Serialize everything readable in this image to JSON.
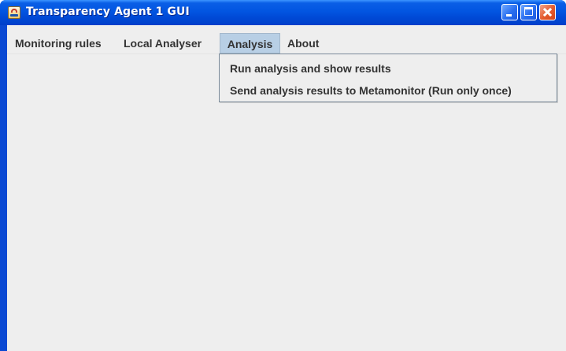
{
  "window": {
    "title": "Transparency Agent 1 GUI",
    "icon": "java-icon",
    "controls": [
      "minimize-icon",
      "maximize-icon",
      "close-icon"
    ],
    "accent_color": "#0a49d3"
  },
  "menubar": {
    "items": [
      {
        "label": "Monitoring rules"
      },
      {
        "label": "Local Analyser"
      },
      {
        "label": "Analysis",
        "active": true
      },
      {
        "label": "About"
      }
    ]
  },
  "analysis_menu": {
    "items": [
      {
        "label": "Run analysis and show results"
      },
      {
        "label": "Send analysis results to Metamonitor (Run only once)"
      }
    ]
  }
}
